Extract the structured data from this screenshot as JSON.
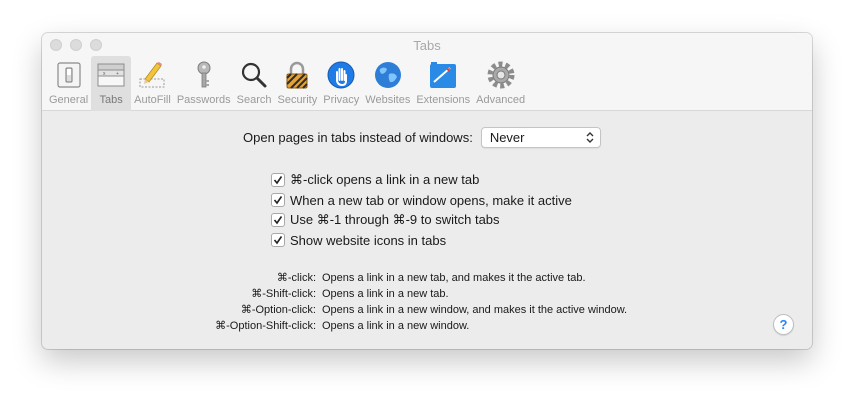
{
  "window": {
    "title": "Tabs"
  },
  "toolbar": {
    "items": [
      {
        "label": "General",
        "icon": "general-switch-icon"
      },
      {
        "label": "Tabs",
        "icon": "tabs-icon",
        "active": true
      },
      {
        "label": "AutoFill",
        "icon": "pencil-icon"
      },
      {
        "label": "Passwords",
        "icon": "key-icon"
      },
      {
        "label": "Search",
        "icon": "magnifier-icon"
      },
      {
        "label": "Security",
        "icon": "padlock-icon"
      },
      {
        "label": "Privacy",
        "icon": "hand-icon"
      },
      {
        "label": "Websites",
        "icon": "globe-icon"
      },
      {
        "label": "Extensions",
        "icon": "puzzle-icon"
      },
      {
        "label": "Advanced",
        "icon": "gear-icon"
      }
    ]
  },
  "tabs_pref": {
    "label": "Open pages in tabs instead of windows:",
    "value": "Never"
  },
  "checkboxes": [
    {
      "label": "⌘-click opens a link in a new tab",
      "checked": true
    },
    {
      "label": "When a new tab or window opens, make it active",
      "checked": true
    },
    {
      "label": "Use ⌘-1 through ⌘-9 to switch tabs",
      "checked": true
    },
    {
      "label": "Show website icons in tabs",
      "checked": true
    }
  ],
  "shortcuts": [
    {
      "key": "⌘-click:",
      "desc": "Opens a link in a new tab, and makes it the active tab."
    },
    {
      "key": "⌘-Shift-click:",
      "desc": "Opens a link in a new tab."
    },
    {
      "key": "⌘-Option-click:",
      "desc": "Opens a link in a new window, and makes it the active window."
    },
    {
      "key": "⌘-Option-Shift-click:",
      "desc": "Opens a link in a new window."
    }
  ],
  "help": {
    "label": "?"
  },
  "colors": {
    "accent": "#2b86f5",
    "window_bg": "#ececec",
    "toolbar_bg": "#f6f6f6"
  }
}
